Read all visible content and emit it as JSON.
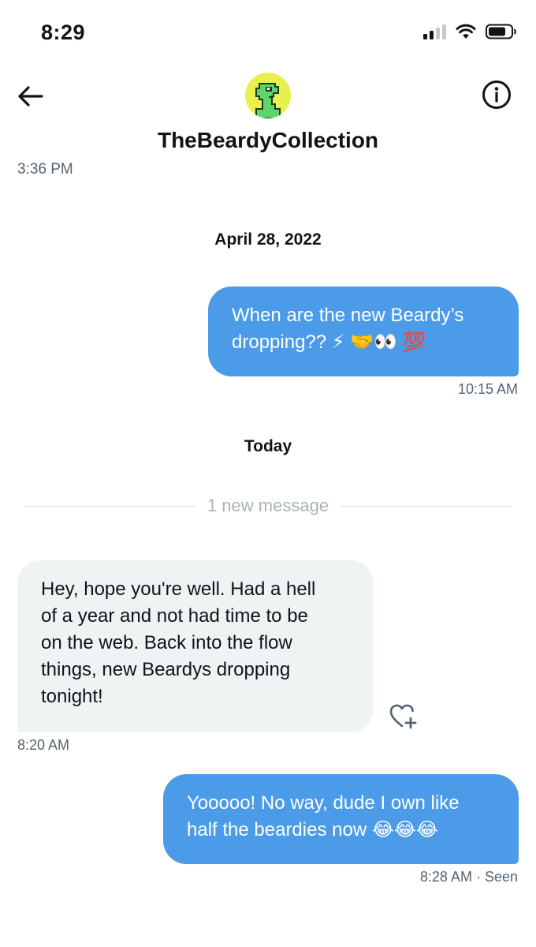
{
  "status_bar": {
    "time": "8:29",
    "icons": [
      "cellular-signal-icon",
      "wifi-icon",
      "battery-icon"
    ]
  },
  "header": {
    "back_icon": "arrow-left-icon",
    "contact_name": "TheBeardyCollection",
    "info_icon": "info-circle-icon",
    "avatar_icon": "pixel-beardy-avatar"
  },
  "conversation": {
    "earlier_timestamp": "3:36 PM",
    "date_1": "April 28, 2022",
    "msg_1": {
      "direction": "outgoing",
      "line_1": "When are the new Beardy’s",
      "line_2": "dropping?? ⚡ 🤝👀 💯",
      "time": "10:15 AM"
    },
    "date_2": "Today",
    "new_message_label": "1 new message",
    "msg_2": {
      "direction": "incoming",
      "lines": [
        "Hey, hope you're well. Had a hell",
        "of a year and not had time to be",
        "on the web. Back into the flow",
        "things, new Beardys dropping",
        "tonight!"
      ],
      "time": "8:20 AM",
      "reaction_icon": "heart-plus-icon"
    },
    "msg_3": {
      "direction": "outgoing",
      "line_1": "Yooooo! No way, dude I own like",
      "line_2": "half the beardies now 😂😂😂",
      "time": "8:28 AM",
      "status": "· Seen"
    }
  },
  "colors": {
    "outgoing_bubble": "#4c9be8",
    "incoming_bubble": "#eff3f4",
    "meta_text": "#536471",
    "avatar_bg": "#e9f04d",
    "avatar_figure": "#5ed46b"
  }
}
